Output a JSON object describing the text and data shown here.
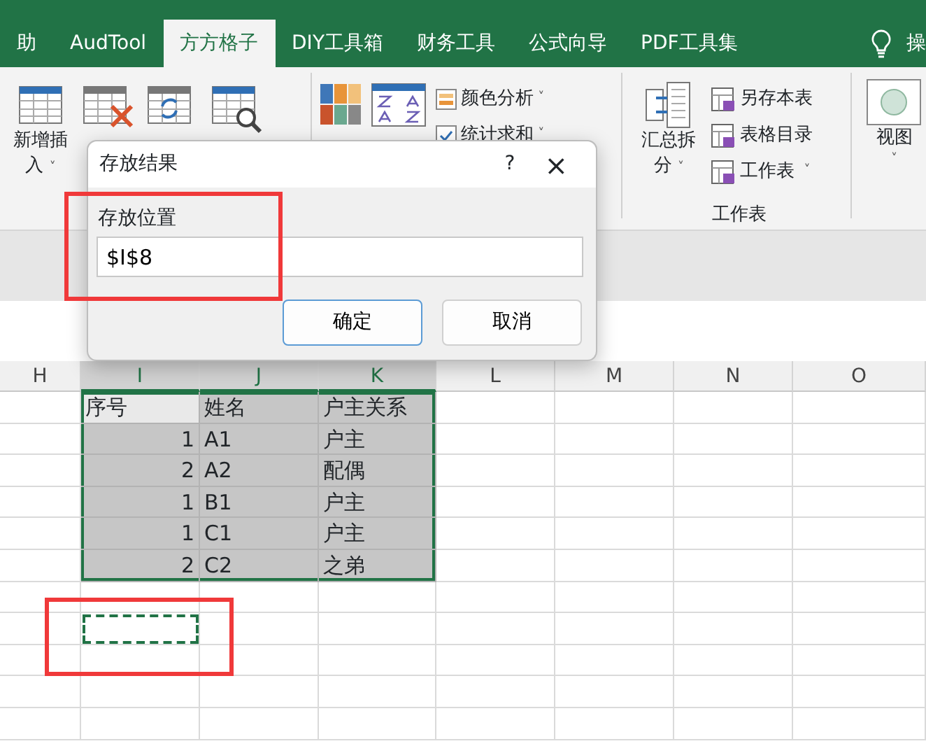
{
  "tabs": [
    {
      "label": "助",
      "selected": false
    },
    {
      "label": "AudTool",
      "selected": false
    },
    {
      "label": "方方格子",
      "selected": true
    },
    {
      "label": "DIY工具箱",
      "selected": false
    },
    {
      "label": "财务工具",
      "selected": false
    },
    {
      "label": "公式向导",
      "selected": false
    },
    {
      "label": "PDF工具集",
      "selected": false
    }
  ],
  "tell_me": {
    "label": "操"
  },
  "ribbon": {
    "insert_button": {
      "lines": [
        "新增插",
        "入"
      ],
      "caret": "˅"
    },
    "color_analysis": {
      "label": "颜色分析",
      "caret": "˅"
    },
    "sum_stats": {
      "label": "统计求和",
      "caret": "˅"
    },
    "split_button": {
      "lines": [
        "汇总拆",
        "分"
      ],
      "caret": "˅"
    },
    "sheet_items": [
      {
        "label": "另存本表"
      },
      {
        "label": "表格目录"
      },
      {
        "label": "工作表",
        "caret": "˅"
      }
    ],
    "sheet_group_label": "工作表",
    "view_button": {
      "label": "视图",
      "caret": "˅"
    }
  },
  "dialog": {
    "title": "存放结果",
    "help": "?",
    "close": "×",
    "field_label": "存放位置",
    "field_value": "$I$8",
    "ok": "确定",
    "cancel": "取消"
  },
  "sheet": {
    "columns": [
      {
        "name": "H",
        "selected": false
      },
      {
        "name": "I",
        "selected": true
      },
      {
        "name": "J",
        "selected": true
      },
      {
        "name": "K",
        "selected": true
      },
      {
        "name": "L",
        "selected": false
      },
      {
        "name": "M",
        "selected": false
      },
      {
        "name": "N",
        "selected": false
      },
      {
        "name": "O",
        "selected": false
      }
    ],
    "rows": [
      {
        "kind": "header",
        "selected": true,
        "marquee": false,
        "cells": [
          "",
          "序号",
          "姓名",
          "户主关系",
          "",
          "",
          "",
          ""
        ]
      },
      {
        "kind": "data",
        "selected": true,
        "marquee": false,
        "cells": [
          "",
          "1",
          "A1",
          "户主",
          "",
          "",
          "",
          ""
        ]
      },
      {
        "kind": "data",
        "selected": true,
        "marquee": false,
        "cells": [
          "",
          "2",
          "A2",
          "配偶",
          "",
          "",
          "",
          ""
        ]
      },
      {
        "kind": "data",
        "selected": true,
        "marquee": false,
        "cells": [
          "",
          "1",
          "B1",
          "户主",
          "",
          "",
          "",
          ""
        ]
      },
      {
        "kind": "data",
        "selected": true,
        "marquee": false,
        "cells": [
          "",
          "1",
          "C1",
          "户主",
          "",
          "",
          "",
          ""
        ]
      },
      {
        "kind": "data",
        "selected": true,
        "marquee": false,
        "cells": [
          "",
          "2",
          "C2",
          "之弟",
          "",
          "",
          "",
          ""
        ]
      },
      {
        "kind": "empty",
        "selected": false,
        "marquee": false,
        "cells": [
          "",
          "",
          "",
          "",
          "",
          "",
          "",
          ""
        ]
      },
      {
        "kind": "empty",
        "selected": false,
        "marquee": true,
        "cells": [
          "",
          "",
          "",
          "",
          "",
          "",
          "",
          ""
        ]
      },
      {
        "kind": "empty",
        "selected": false,
        "marquee": false,
        "cells": [
          "",
          "",
          "",
          "",
          "",
          "",
          "",
          ""
        ]
      },
      {
        "kind": "empty",
        "selected": false,
        "marquee": false,
        "cells": [
          "",
          "",
          "",
          "",
          "",
          "",
          "",
          ""
        ]
      },
      {
        "kind": "empty",
        "selected": false,
        "marquee": false,
        "cells": [
          "",
          "",
          "",
          "",
          "",
          "",
          "",
          ""
        ]
      }
    ]
  }
}
